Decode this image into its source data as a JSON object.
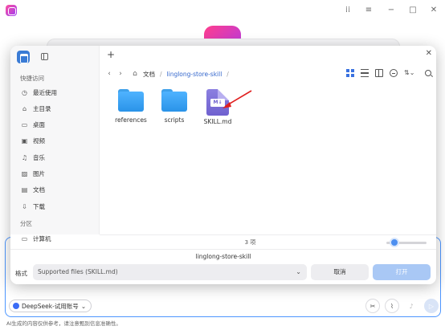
{
  "background_app": {
    "model_chip": "DeepSeek-试用账号",
    "disclaimer": "AI生成的内容仅供参考，请注意甄别信息准确性。"
  },
  "dialog": {
    "sidebar": {
      "quick_access_label": "快捷访问",
      "quick_items": [
        {
          "label": "最近使用",
          "icon": "clock-icon"
        },
        {
          "label": "主目录",
          "icon": "home-icon"
        },
        {
          "label": "桌面",
          "icon": "desktop-icon"
        },
        {
          "label": "视频",
          "icon": "video-icon"
        },
        {
          "label": "音乐",
          "icon": "music-icon"
        },
        {
          "label": "图片",
          "icon": "image-icon"
        },
        {
          "label": "文档",
          "icon": "document-icon"
        },
        {
          "label": "下载",
          "icon": "download-icon"
        }
      ],
      "partition_label": "分区",
      "computer_label": "计算机"
    },
    "breadcrumb": {
      "root": "文档",
      "current": "linglong-store-skill"
    },
    "files": [
      {
        "name": "references",
        "type": "folder"
      },
      {
        "name": "scripts",
        "type": "folder"
      },
      {
        "name": "SKILL.md",
        "type": "markdown"
      }
    ],
    "md_badge": "M↓",
    "item_count": "3 项",
    "folder_title": "linglong-store-skill",
    "format_label": "格式",
    "format_value": "Supported files (SKILL.md)",
    "cancel_label": "取消",
    "open_label": "打开"
  }
}
